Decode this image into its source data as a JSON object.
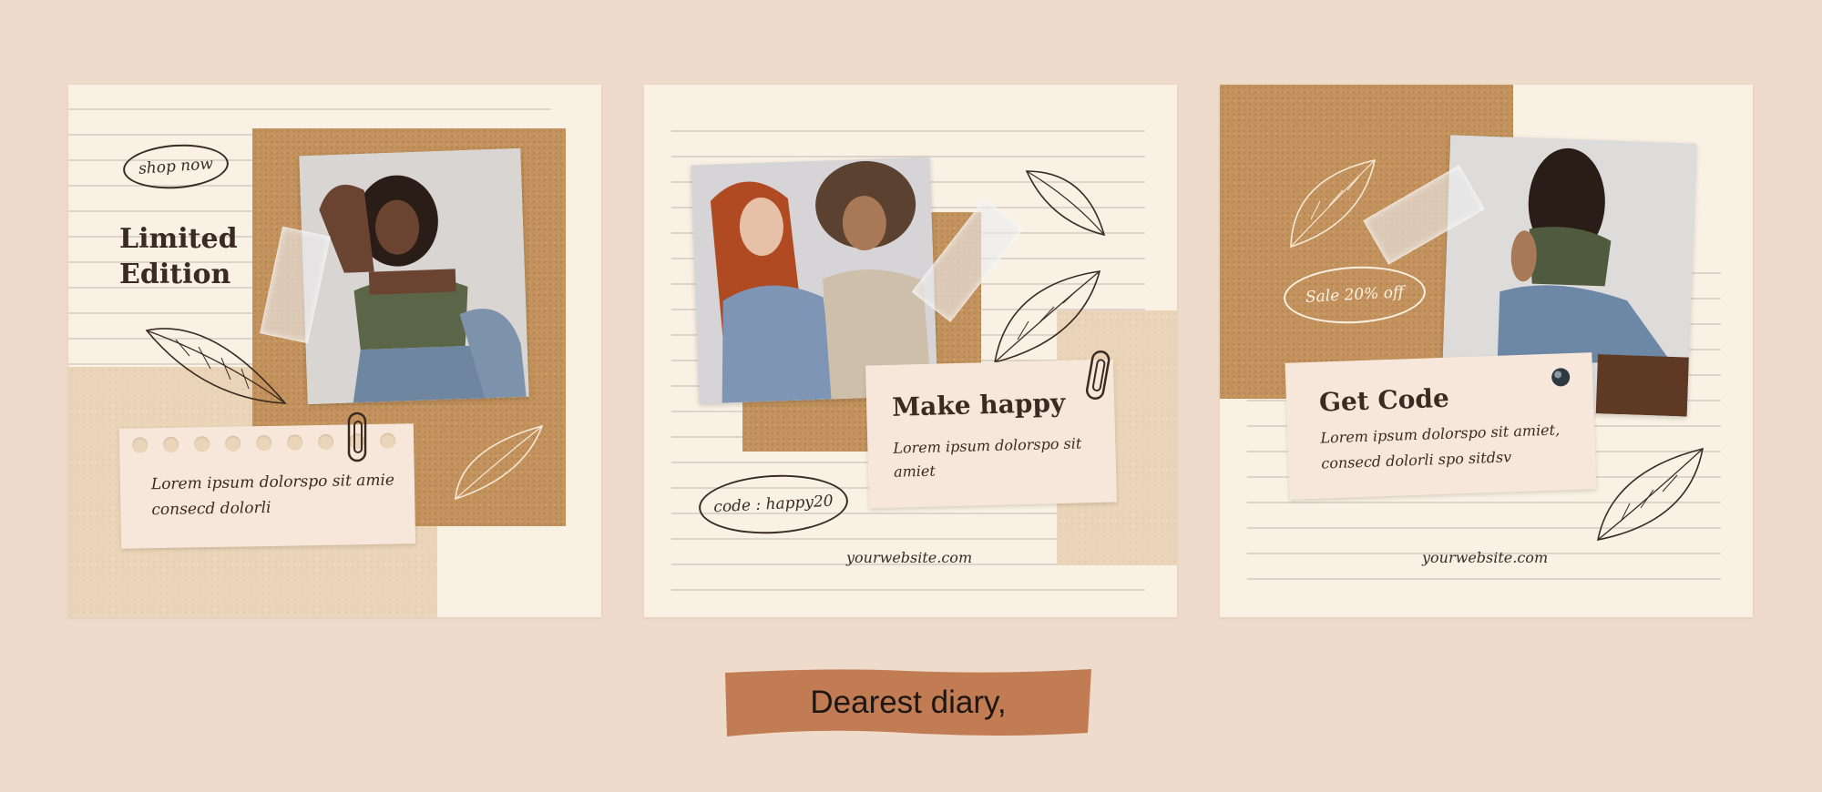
{
  "colors": {
    "background": "#efdbcc",
    "card": "#f8f1e4",
    "kraft": "#c4935d",
    "beige": "#ebd5b9",
    "note": "#f6e7da",
    "ink": "#3b2a22",
    "caption_band": "#c17c54"
  },
  "cards": [
    {
      "title_line1": "Limited",
      "title_line2": "Edition",
      "badge": "shop now",
      "body_line1": "Lorem ipsum dolorspo sit amie",
      "body_line2": "consecd dolorli",
      "icons": [
        "leaf-sketch-icon",
        "paper-clip-icon",
        "leaf-outline-icon"
      ]
    },
    {
      "title": "Make happy",
      "body_line1": "Lorem ipsum dolorspo sit",
      "body_line2": "amiet",
      "badge": "code : happy20",
      "website": "yourwebsite.com",
      "icons": [
        "leaf-sketch-icon",
        "paper-clip-icon"
      ]
    },
    {
      "badge": "Sale 20% off",
      "title": "Get Code",
      "body_line1": "Lorem ipsum dolorspo sit amiet,",
      "body_line2": "consecd dolorli spo sitdsv",
      "website": "yourwebsite.com",
      "icons": [
        "leaf-sketch-icon",
        "pushpin-icon"
      ]
    }
  ],
  "caption": "Dearest diary,"
}
